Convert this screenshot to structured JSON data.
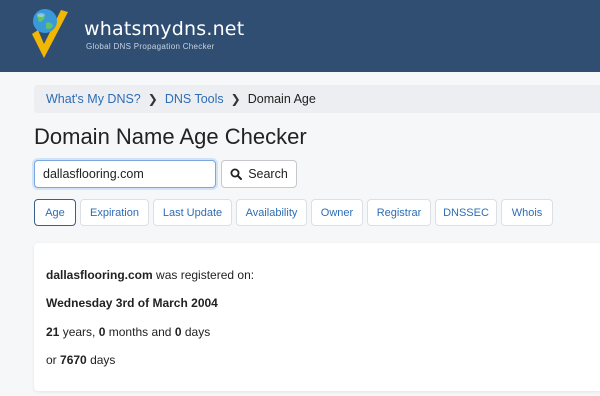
{
  "brand": {
    "name": "whatsmydns.net",
    "tagline": "Global DNS Propagation Checker"
  },
  "breadcrumb": {
    "items": [
      "What's My DNS?",
      "DNS Tools"
    ],
    "current": "Domain Age"
  },
  "page_title": "Domain Name Age Checker",
  "search": {
    "value": "dallasflooring.com",
    "button_label": "Search",
    "button_icon": "search-icon"
  },
  "tabs": [
    {
      "label": "Age",
      "active": true
    },
    {
      "label": "Expiration",
      "active": false
    },
    {
      "label": "Last Update",
      "active": false
    },
    {
      "label": "Availability",
      "active": false
    },
    {
      "label": "Owner",
      "active": false
    },
    {
      "label": "Registrar",
      "active": false
    },
    {
      "label": "DNSSEC",
      "active": false
    },
    {
      "label": "Whois",
      "active": false
    }
  ],
  "result": {
    "domain": "dallasflooring.com",
    "registered_text": "was registered on:",
    "registered_date": "Wednesday 3rd of March 2004",
    "years": "21",
    "years_label": "years,",
    "months": "0",
    "months_label": "months and",
    "days": "0",
    "days_label": "days",
    "or_label": "or",
    "total_days": "7670",
    "total_days_label": "days"
  },
  "colors": {
    "header_bg": "#2f4e71",
    "link": "#2d6db5",
    "logo_check": "#f2b705",
    "logo_globe": "#3a9ad9"
  }
}
